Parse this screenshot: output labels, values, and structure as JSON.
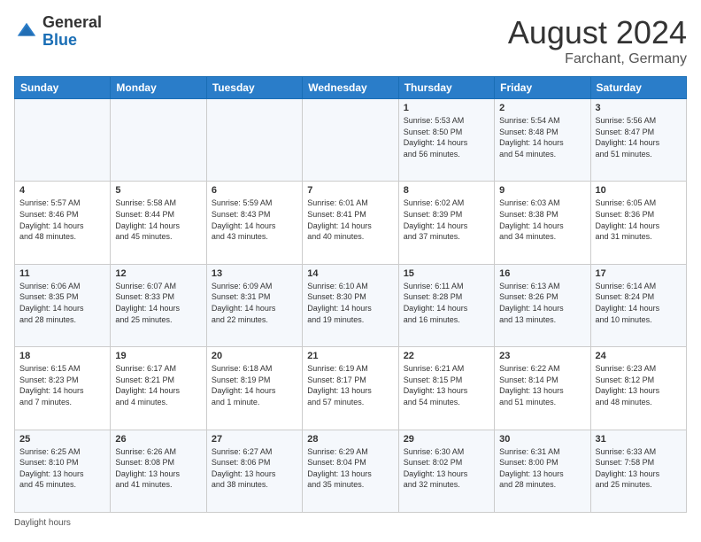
{
  "header": {
    "logo": {
      "general": "General",
      "blue": "Blue"
    },
    "title": "August 2024",
    "subtitle": "Farchant, Germany"
  },
  "days_of_week": [
    "Sunday",
    "Monday",
    "Tuesday",
    "Wednesday",
    "Thursday",
    "Friday",
    "Saturday"
  ],
  "weeks": [
    {
      "days": [
        {
          "number": null,
          "info": null
        },
        {
          "number": null,
          "info": null
        },
        {
          "number": null,
          "info": null
        },
        {
          "number": null,
          "info": null
        },
        {
          "number": "1",
          "info": "Sunrise: 5:53 AM\nSunset: 8:50 PM\nDaylight: 14 hours\nand 56 minutes."
        },
        {
          "number": "2",
          "info": "Sunrise: 5:54 AM\nSunset: 8:48 PM\nDaylight: 14 hours\nand 54 minutes."
        },
        {
          "number": "3",
          "info": "Sunrise: 5:56 AM\nSunset: 8:47 PM\nDaylight: 14 hours\nand 51 minutes."
        }
      ]
    },
    {
      "days": [
        {
          "number": "4",
          "info": "Sunrise: 5:57 AM\nSunset: 8:46 PM\nDaylight: 14 hours\nand 48 minutes."
        },
        {
          "number": "5",
          "info": "Sunrise: 5:58 AM\nSunset: 8:44 PM\nDaylight: 14 hours\nand 45 minutes."
        },
        {
          "number": "6",
          "info": "Sunrise: 5:59 AM\nSunset: 8:43 PM\nDaylight: 14 hours\nand 43 minutes."
        },
        {
          "number": "7",
          "info": "Sunrise: 6:01 AM\nSunset: 8:41 PM\nDaylight: 14 hours\nand 40 minutes."
        },
        {
          "number": "8",
          "info": "Sunrise: 6:02 AM\nSunset: 8:39 PM\nDaylight: 14 hours\nand 37 minutes."
        },
        {
          "number": "9",
          "info": "Sunrise: 6:03 AM\nSunset: 8:38 PM\nDaylight: 14 hours\nand 34 minutes."
        },
        {
          "number": "10",
          "info": "Sunrise: 6:05 AM\nSunset: 8:36 PM\nDaylight: 14 hours\nand 31 minutes."
        }
      ]
    },
    {
      "days": [
        {
          "number": "11",
          "info": "Sunrise: 6:06 AM\nSunset: 8:35 PM\nDaylight: 14 hours\nand 28 minutes."
        },
        {
          "number": "12",
          "info": "Sunrise: 6:07 AM\nSunset: 8:33 PM\nDaylight: 14 hours\nand 25 minutes."
        },
        {
          "number": "13",
          "info": "Sunrise: 6:09 AM\nSunset: 8:31 PM\nDaylight: 14 hours\nand 22 minutes."
        },
        {
          "number": "14",
          "info": "Sunrise: 6:10 AM\nSunset: 8:30 PM\nDaylight: 14 hours\nand 19 minutes."
        },
        {
          "number": "15",
          "info": "Sunrise: 6:11 AM\nSunset: 8:28 PM\nDaylight: 14 hours\nand 16 minutes."
        },
        {
          "number": "16",
          "info": "Sunrise: 6:13 AM\nSunset: 8:26 PM\nDaylight: 14 hours\nand 13 minutes."
        },
        {
          "number": "17",
          "info": "Sunrise: 6:14 AM\nSunset: 8:24 PM\nDaylight: 14 hours\nand 10 minutes."
        }
      ]
    },
    {
      "days": [
        {
          "number": "18",
          "info": "Sunrise: 6:15 AM\nSunset: 8:23 PM\nDaylight: 14 hours\nand 7 minutes."
        },
        {
          "number": "19",
          "info": "Sunrise: 6:17 AM\nSunset: 8:21 PM\nDaylight: 14 hours\nand 4 minutes."
        },
        {
          "number": "20",
          "info": "Sunrise: 6:18 AM\nSunset: 8:19 PM\nDaylight: 14 hours\nand 1 minute."
        },
        {
          "number": "21",
          "info": "Sunrise: 6:19 AM\nSunset: 8:17 PM\nDaylight: 13 hours\nand 57 minutes."
        },
        {
          "number": "22",
          "info": "Sunrise: 6:21 AM\nSunset: 8:15 PM\nDaylight: 13 hours\nand 54 minutes."
        },
        {
          "number": "23",
          "info": "Sunrise: 6:22 AM\nSunset: 8:14 PM\nDaylight: 13 hours\nand 51 minutes."
        },
        {
          "number": "24",
          "info": "Sunrise: 6:23 AM\nSunset: 8:12 PM\nDaylight: 13 hours\nand 48 minutes."
        }
      ]
    },
    {
      "days": [
        {
          "number": "25",
          "info": "Sunrise: 6:25 AM\nSunset: 8:10 PM\nDaylight: 13 hours\nand 45 minutes."
        },
        {
          "number": "26",
          "info": "Sunrise: 6:26 AM\nSunset: 8:08 PM\nDaylight: 13 hours\nand 41 minutes."
        },
        {
          "number": "27",
          "info": "Sunrise: 6:27 AM\nSunset: 8:06 PM\nDaylight: 13 hours\nand 38 minutes."
        },
        {
          "number": "28",
          "info": "Sunrise: 6:29 AM\nSunset: 8:04 PM\nDaylight: 13 hours\nand 35 minutes."
        },
        {
          "number": "29",
          "info": "Sunrise: 6:30 AM\nSunset: 8:02 PM\nDaylight: 13 hours\nand 32 minutes."
        },
        {
          "number": "30",
          "info": "Sunrise: 6:31 AM\nSunset: 8:00 PM\nDaylight: 13 hours\nand 28 minutes."
        },
        {
          "number": "31",
          "info": "Sunrise: 6:33 AM\nSunset: 7:58 PM\nDaylight: 13 hours\nand 25 minutes."
        }
      ]
    }
  ],
  "footer": {
    "daylight_hours_label": "Daylight hours"
  }
}
